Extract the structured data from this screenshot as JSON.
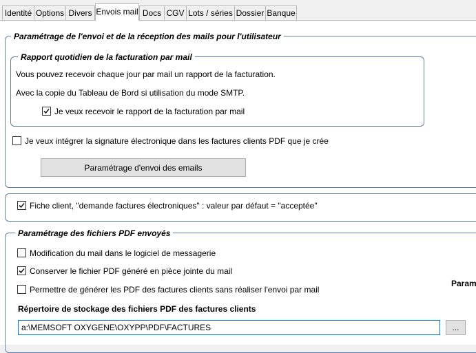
{
  "tabs": [
    {
      "label": "Identité"
    },
    {
      "label": "Options"
    },
    {
      "label": "Divers"
    },
    {
      "label": "Envois mail"
    },
    {
      "label": "Docs"
    },
    {
      "label": "CGV"
    },
    {
      "label": "Lots / séries"
    },
    {
      "label": "Dossier"
    },
    {
      "label": "Banque"
    }
  ],
  "active_tab": "Envois mail",
  "mail_settings": {
    "title": "Paramétrage de l'envoi et de la réception des mails pour l'utilisateur",
    "daily_report": {
      "title": "Rapport quotidien de la facturation par mail",
      "line1": "Vous pouvez recevoir chaque jour par mail un rapport de la facturation.",
      "line2": "Avec la copie du Tableau de Bord si utilisation du mode SMTP.",
      "checkbox": {
        "label": "Je veux recevoir le rapport de la facturation par mail",
        "checked": true
      }
    },
    "signature_checkbox": {
      "label": "Je veux intégrer la signature électronique dans les factures clients PDF que je crée",
      "checked": false
    },
    "email_settings_button": "Paramétrage d'envoi des emails"
  },
  "client_card": {
    "checkbox": {
      "label": "Fiche client, \"demande factures électroniques\" : valeur par défaut = \"acceptée\"",
      "checked": true
    }
  },
  "pdf_settings": {
    "title": "Paramétrage des fichiers PDF envoyés",
    "options": [
      {
        "label": "Modification du mail dans le logiciel de messagerie",
        "checked": false
      },
      {
        "label": "Conserver le fichier PDF généré en pièce jointe du mail",
        "checked": true
      },
      {
        "label": "Permettre de générer les PDF des factures clients sans réaliser l'envoi par mail",
        "checked": false
      }
    ],
    "side_label": "Param",
    "directory_label": "Répertoire de stockage des fichiers PDF des factures clients",
    "directory_value": "a:\\MEMSOFT OXYGENE\\OXYPP\\PDF\\FACTURES",
    "browse_button": "..."
  },
  "colors": {
    "group_border": "#5d7fa8",
    "input_focus_border": "#0078d7",
    "button_bg": "#e1e1e1"
  }
}
